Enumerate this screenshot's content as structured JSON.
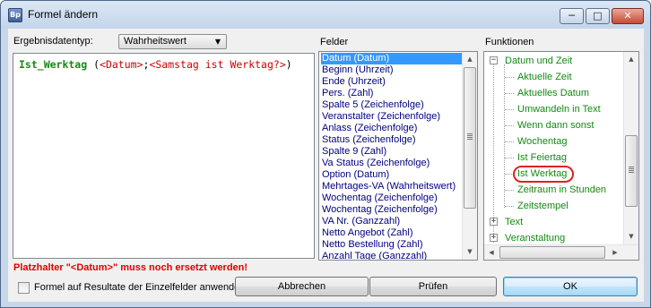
{
  "window": {
    "title": "Formel ändern",
    "icon_text": "Bp",
    "minimize_glyph": "─",
    "maximize_glyph": "□",
    "close_glyph": "✕"
  },
  "result_type": {
    "label": "Ergebnisdatentyp:",
    "selected": "Wahrheitswert",
    "arrow": "▼"
  },
  "editor": {
    "function_name": "Ist_Werktag",
    "open": " (",
    "param1": "<Datum>",
    "separator": ";",
    "param2": "<Samstag ist Werktag?>",
    "close": ")"
  },
  "fields": {
    "heading": "Felder",
    "items": [
      "Datum (Datum)",
      "Beginn (Uhrzeit)",
      "Ende (Uhrzeit)",
      "Pers. (Zahl)",
      "Spalte 5 (Zeichenfolge)",
      "Veranstalter (Zeichenfolge)",
      "Anlass (Zeichenfolge)",
      "Status (Zeichenfolge)",
      "Spalte 9 (Zahl)",
      "Va Status (Zeichenfolge)",
      "Option (Datum)",
      "Mehrtages-VA (Wahrheitswert)",
      "Wochentag (Zeichenfolge)",
      "Wochentag (Zeichenfolge)",
      "VA Nr. (Ganzzahl)",
      "Netto Angebot (Zahl)",
      "Netto Bestellung (Zahl)",
      "Anzahl Tage (Ganzzahl)"
    ],
    "selected_index": 0
  },
  "functions": {
    "heading": "Funktionen",
    "group_datetime": {
      "label": "Datum und Zeit",
      "expander": "−",
      "children": [
        "Aktuelle Zeit",
        "Aktuelles Datum",
        "Umwandeln in Text",
        "Wenn dann sonst",
        "Wochentag",
        "Ist Feiertag",
        "Ist Werktag",
        "Zeitraum in Stunden",
        "Zeitstempel"
      ],
      "highlighted": "Ist Werktag"
    },
    "group_text": {
      "label": "Text",
      "expander": "+"
    },
    "group_event": {
      "label": "Veranstaltung",
      "expander": "+"
    }
  },
  "warning": "Platzhalter \"<Datum>\" muss noch ersetzt werden!",
  "checkbox": {
    "label": "Formel auf Resultate der Einzelfelder anwenden",
    "checked": false
  },
  "buttons": {
    "cancel": "Abbrechen",
    "check": "Prüfen",
    "ok": "OK"
  },
  "scroll": {
    "up": "▲",
    "down": "▼"
  },
  "colors": {
    "function_green": "#138a13",
    "placeholder_red": "#d00000",
    "warning_red": "#e00000",
    "field_text": "#000080",
    "selection_blue": "#3399ff",
    "highlight_ring": "#e0201c"
  }
}
